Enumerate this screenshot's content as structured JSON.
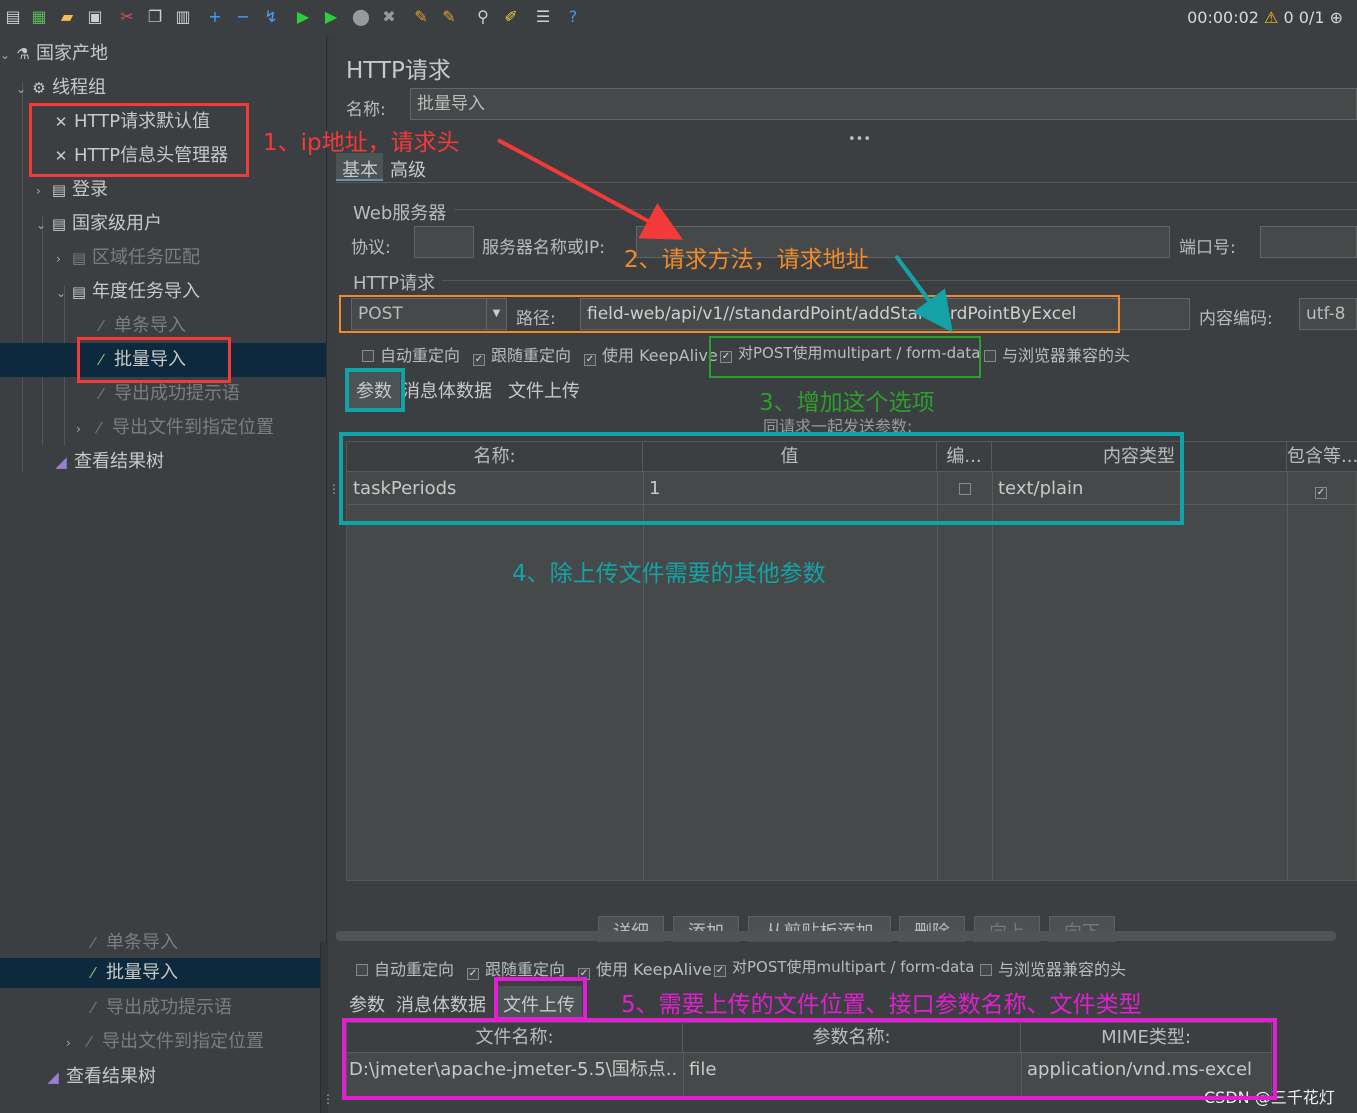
{
  "toolbar": {
    "timer": "00:00:02",
    "warnings": "0",
    "threads": "0/1",
    "icons": [
      "new-icon",
      "templates-icon",
      "open-icon",
      "save-icon",
      "cut-icon",
      "copy-icon",
      "paste-icon",
      "expand-icon",
      "collapse-icon",
      "toggle-icon",
      "start-icon",
      "start-no-pause-icon",
      "stop-icon",
      "shutdown-icon",
      "clear-icon",
      "clear-all-icon",
      "search-icon",
      "reset-search-icon",
      "function-helper-icon",
      "help-icon"
    ]
  },
  "tree": {
    "items": [
      {
        "label": "国家产地",
        "icon": "flask-icon"
      },
      {
        "label": "线程组",
        "icon": "gear-icon"
      },
      {
        "label": "HTTP请求默认值",
        "icon": "wrench-icon"
      },
      {
        "label": "HTTP信息头管理器",
        "icon": "wrench-icon"
      },
      {
        "label": "登录",
        "icon": "controller-icon"
      },
      {
        "label": "国家级用户",
        "icon": "controller-icon"
      },
      {
        "label": "区域任务匹配",
        "icon": "controller-icon"
      },
      {
        "label": "年度任务导入",
        "icon": "controller-icon"
      },
      {
        "label": "单条导入",
        "icon": "pipette-icon"
      },
      {
        "label": "批量导入",
        "icon": "pipette-icon"
      },
      {
        "label": "导出成功提示语",
        "icon": "pipette-icon"
      },
      {
        "label": "导出文件到指定位置",
        "icon": "pipette-icon"
      },
      {
        "label": "查看结果树",
        "icon": "chart-icon"
      }
    ]
  },
  "panel": {
    "title": "HTTP请求",
    "name_label": "名称:",
    "name_value": "批量导入",
    "tabs": {
      "basic": "基本",
      "advanced": "高级"
    },
    "web_server": {
      "legend": "Web服务器",
      "protocol_label": "协议:",
      "server_label": "服务器名称或IP:",
      "port_label": "端口号:"
    },
    "http_request": {
      "legend": "HTTP请求",
      "method": "POST",
      "path_label": "路径:",
      "path_value": "field-web/api/v1//standardPoint/addStandardPointByExcel",
      "encoding_label": "内容编码:",
      "encoding_value": "utf-8"
    },
    "options": {
      "auto_redirect": "自动重定向",
      "follow_redirect": "跟随重定向",
      "keepalive": "使用 KeepAlive",
      "multipart": "对POST使用multipart / form-data",
      "browser_headers": "与浏览器兼容的头"
    },
    "subtabs": {
      "params": "参数",
      "body": "消息体数据",
      "files": "文件上传"
    },
    "params_caption": "同请求一起发送参数:",
    "params_table": {
      "headers": [
        "名称:",
        "值",
        "编...",
        "内容类型",
        "包含等..."
      ],
      "rows": [
        {
          "name": "taskPeriods",
          "value": "1",
          "content_type": "text/plain"
        }
      ]
    },
    "buttons": {
      "detail": "详细",
      "add": "添加",
      "add_clipboard": "从剪贴板添加",
      "delete": "删除",
      "up": "向上",
      "down": "向下"
    }
  },
  "bottom": {
    "tree_items": [
      "单条导入",
      "批量导入",
      "导出成功提示语",
      "导出文件到指定位置",
      "查看结果树"
    ],
    "files_table": {
      "headers": [
        "文件名称:",
        "参数名称:",
        "MIME类型:"
      ],
      "rows": [
        {
          "file": "D:\\jmeter\\apache-jmeter-5.5\\国标点...",
          "param": "file",
          "mime": "application/vnd.ms-excel"
        }
      ]
    },
    "watermark": "CSDN @三千花灯"
  },
  "annotations": {
    "a1": "1、ip地址，请求头",
    "a2": "2、请求方法，请求地址",
    "a3": "3、增加这个选项",
    "a4": "4、除上传文件需要的其他参数",
    "a5": "5、需要上传的文件位置、接口参数名称、文件类型",
    "colors": {
      "red": "#f23a3a",
      "orange": "#f08a2a",
      "green": "#2e9e2e",
      "teal": "#13a3a6",
      "magenta": "#e020d0"
    }
  }
}
